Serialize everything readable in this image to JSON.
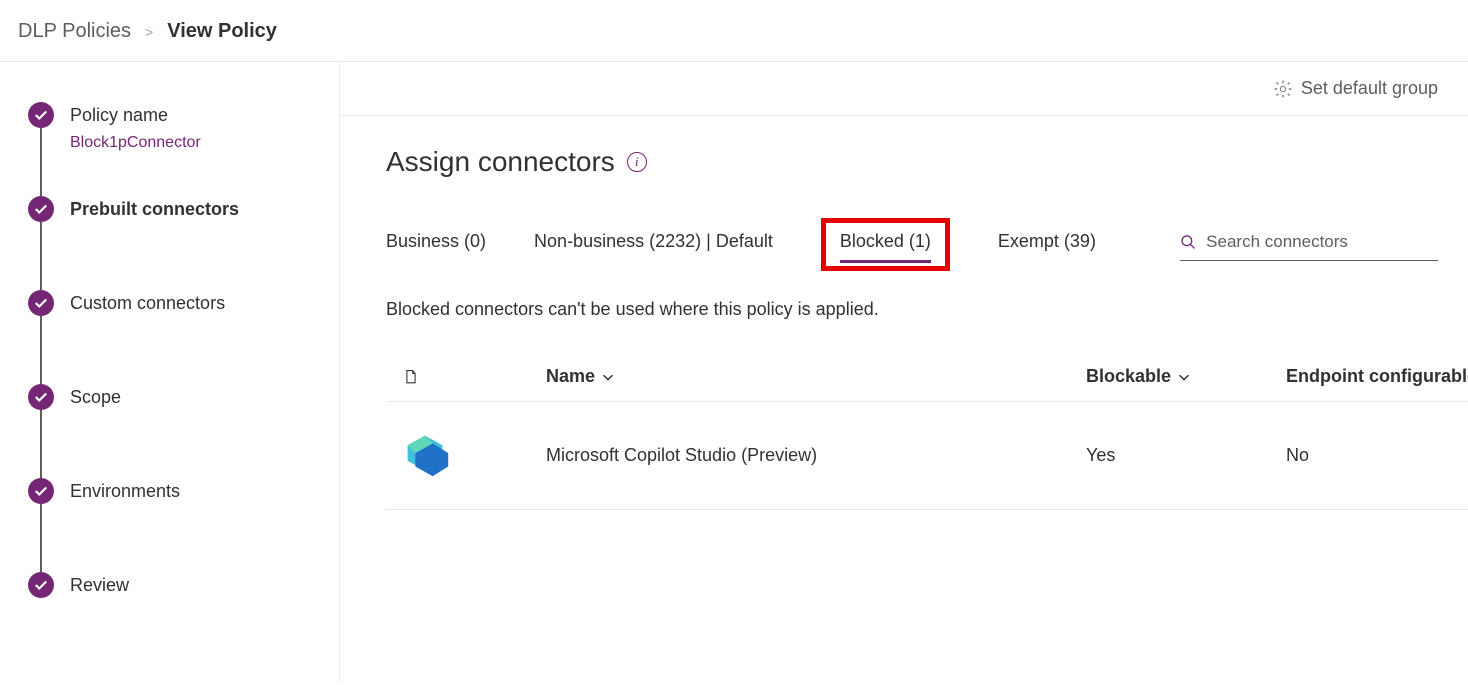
{
  "breadcrumb": {
    "parent": "DLP Policies",
    "current": "View Policy"
  },
  "sidebar": {
    "steps": [
      {
        "label": "Policy name",
        "sub": "Block1pConnector"
      },
      {
        "label": "Prebuilt connectors"
      },
      {
        "label": "Custom connectors"
      },
      {
        "label": "Scope"
      },
      {
        "label": "Environments"
      },
      {
        "label": "Review"
      }
    ]
  },
  "toolbar": {
    "default_group_label": "Set default group"
  },
  "section": {
    "title": "Assign connectors"
  },
  "tabs": {
    "business": "Business (0)",
    "nonbusiness": "Non-business (2232) | Default",
    "blocked": "Blocked (1)",
    "exempt": "Exempt (39)"
  },
  "search": {
    "placeholder": "Search connectors"
  },
  "description": "Blocked connectors can't be used where this policy is applied.",
  "table": {
    "headers": {
      "name": "Name",
      "blockable": "Blockable",
      "endpoint": "Endpoint configurable"
    },
    "rows": [
      {
        "name": "Microsoft Copilot Studio (Preview)",
        "blockable": "Yes",
        "endpoint": "No"
      }
    ]
  }
}
